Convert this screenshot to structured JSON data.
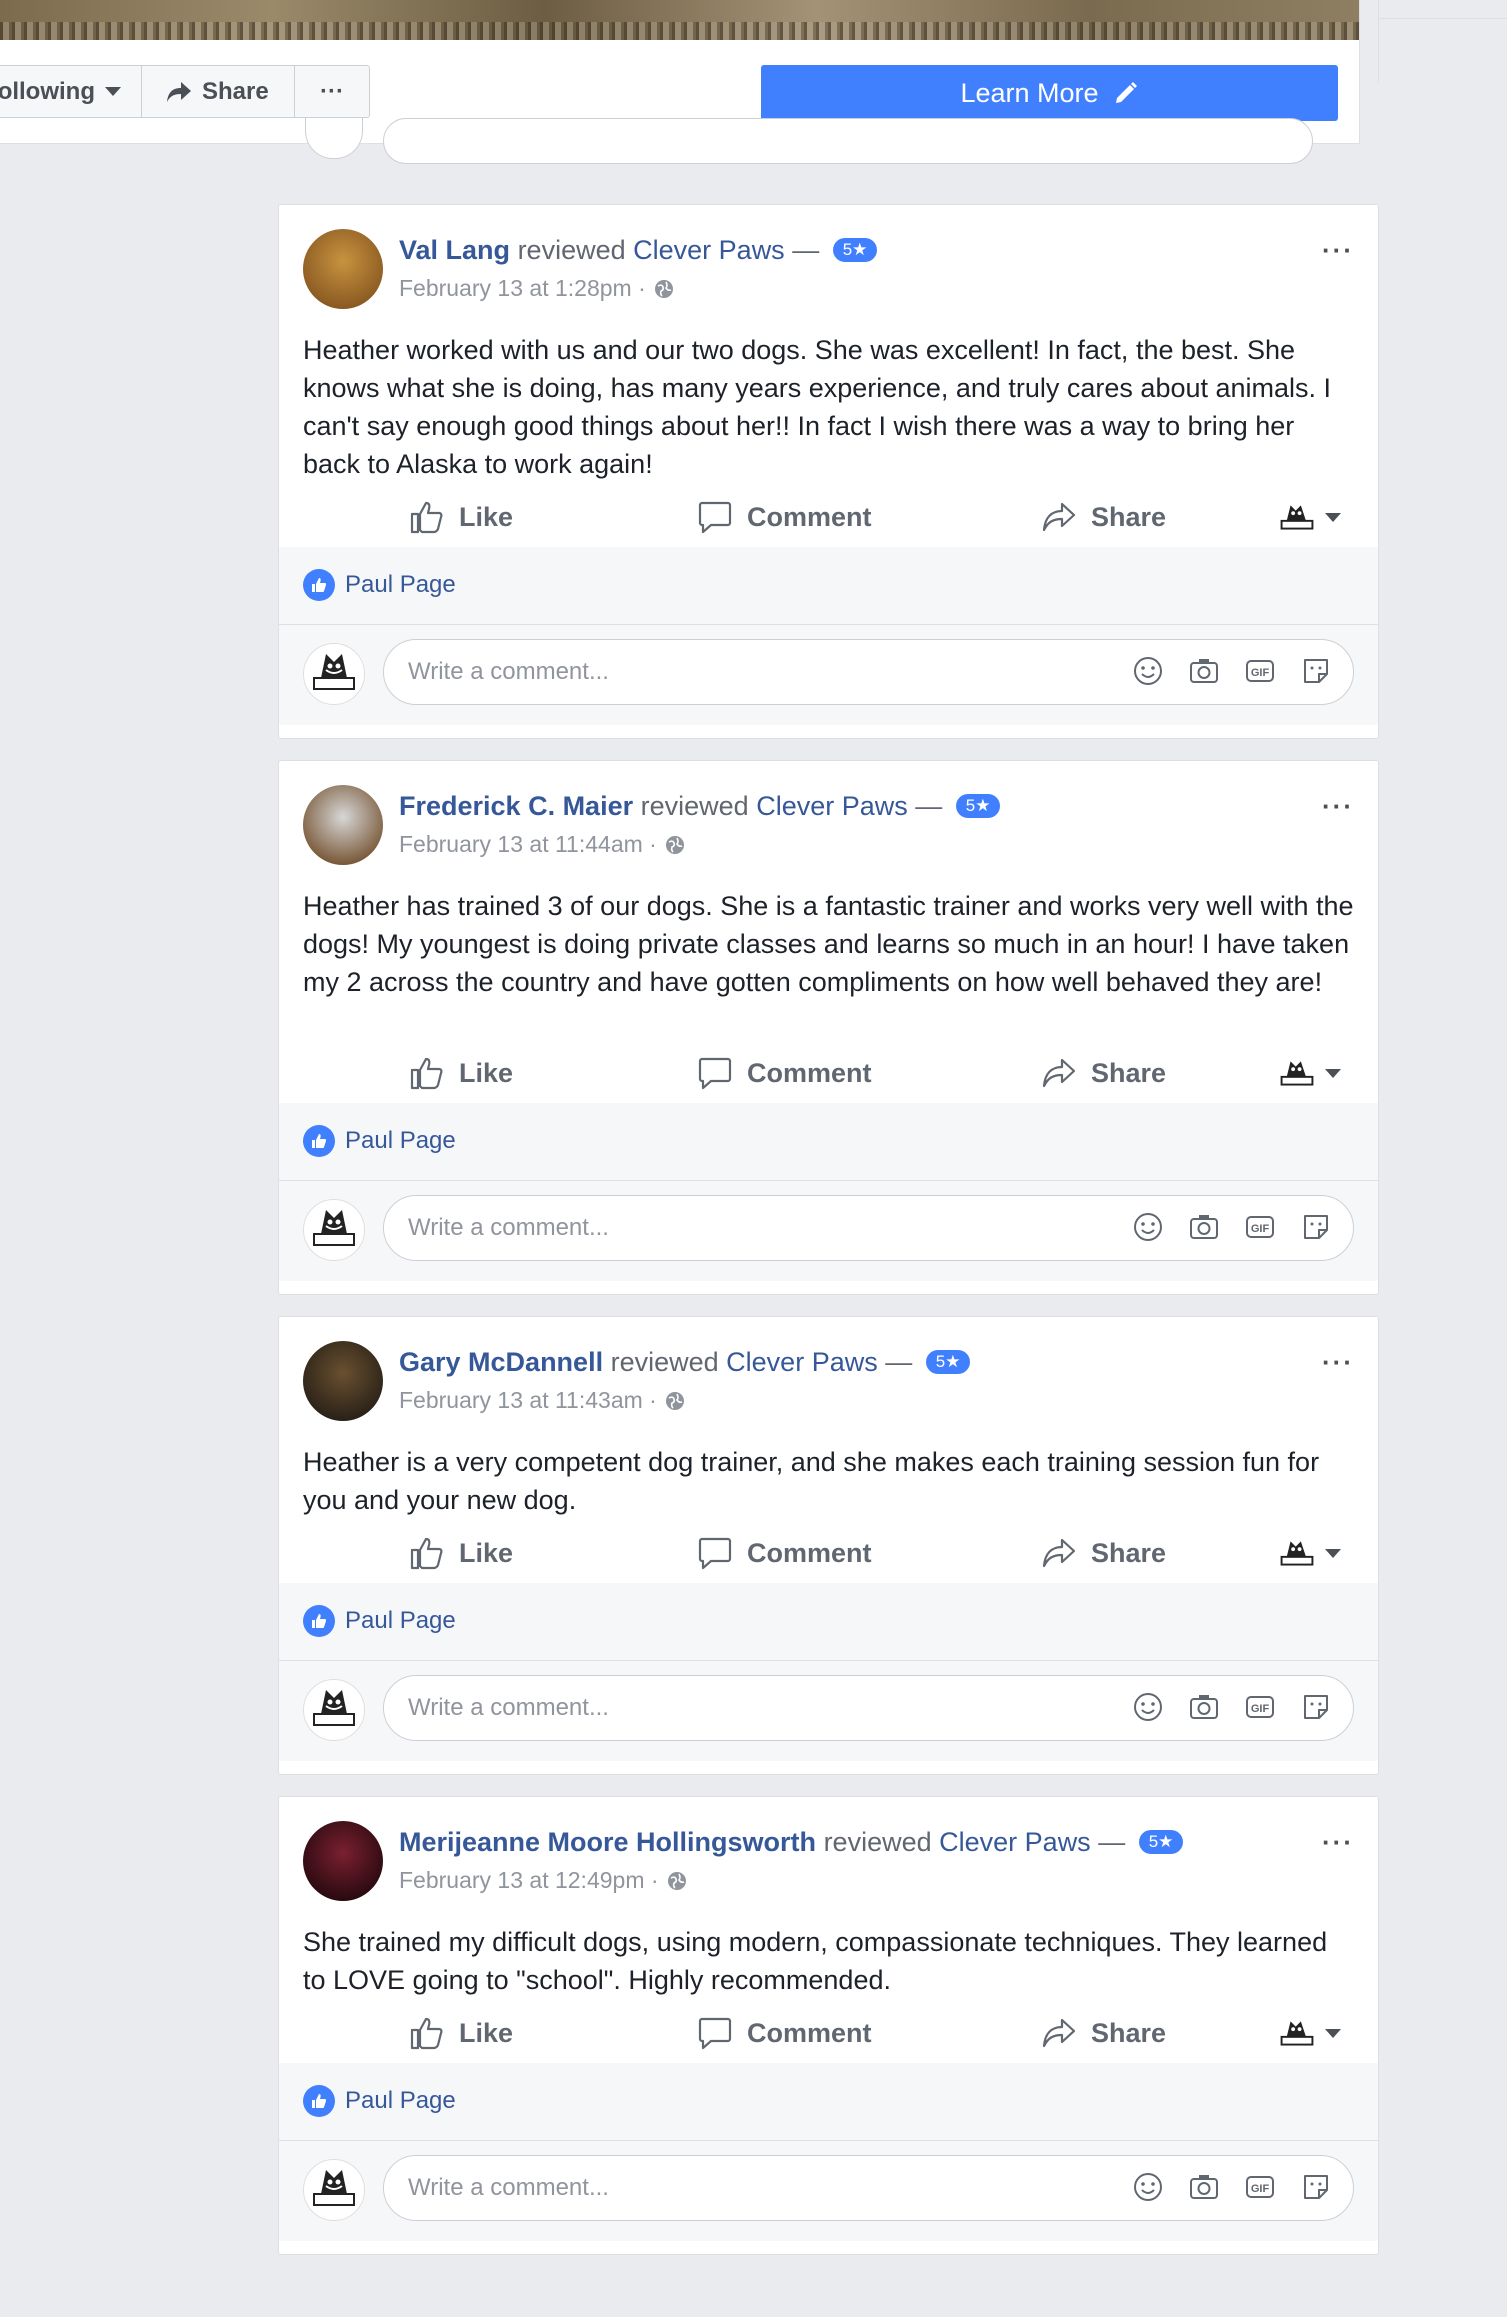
{
  "header": {
    "following_label": "ollowing",
    "share_label": "Share",
    "more_label": "···",
    "learn_more_label": "Learn More"
  },
  "actions": {
    "like": "Like",
    "comment": "Comment",
    "share": "Share"
  },
  "comment_placeholder": "Write a comment...",
  "reviews": [
    {
      "author": "Val Lang",
      "verb": "reviewed",
      "page": "Clever Paws",
      "rating": "5★",
      "timestamp": "February 13 at 1:28pm ·",
      "text": "Heather worked with us and our two dogs. She was excellent! In fact, the best. She knows what she is doing, has many years experience, and truly cares about animals. I can't say enough good things about her!! In fact I wish there was a way to bring her back to Alaska to work again!",
      "liked_by": "Paul Page"
    },
    {
      "author": "Frederick C. Maier",
      "verb": "reviewed",
      "page": "Clever Paws",
      "rating": "5★",
      "timestamp": "February 13 at 11:44am ·",
      "text": "Heather has trained 3 of our dogs. She is a fantastic trainer and works very well with the dogs! My youngest is doing private classes and learns so much in an hour! I have taken my 2 across the country and have gotten compliments on how well behaved they are!",
      "liked_by": "Paul Page"
    },
    {
      "author": "Gary McDannell",
      "verb": "reviewed",
      "page": "Clever Paws",
      "rating": "5★",
      "timestamp": "February 13 at 11:43am ·",
      "text": "Heather is a very competent dog trainer, and she makes each training session fun for you and your new dog.",
      "liked_by": "Paul Page"
    },
    {
      "author": "Merijeanne Moore Hollingsworth",
      "verb": "reviewed",
      "page": "Clever Paws",
      "rating": "5★",
      "timestamp": "February 13 at 12:49pm ·",
      "text": "She trained my difficult dogs, using modern, compassionate techniques. They learned to LOVE going to \"school\". Highly recommended.",
      "liked_by": "Paul Page"
    }
  ],
  "colors": {
    "accent": "#4080ff",
    "link": "#365899",
    "background": "#e9ebee"
  }
}
